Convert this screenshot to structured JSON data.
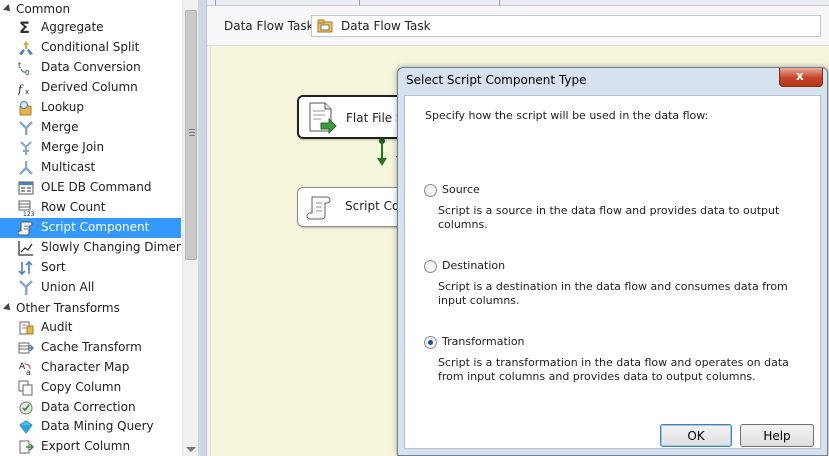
{
  "toolbox": {
    "groups": [
      {
        "label": "Common"
      },
      {
        "label": "Other Transforms"
      }
    ],
    "common_items": [
      {
        "label": "Aggregate",
        "icon": "sigma-icon"
      },
      {
        "label": "Conditional Split",
        "icon": "conditional-split-icon"
      },
      {
        "label": "Data Conversion",
        "icon": "data-conversion-icon"
      },
      {
        "label": "Derived Column",
        "icon": "derived-column-icon"
      },
      {
        "label": "Lookup",
        "icon": "lookup-icon"
      },
      {
        "label": "Merge",
        "icon": "merge-icon"
      },
      {
        "label": "Merge Join",
        "icon": "merge-join-icon"
      },
      {
        "label": "Multicast",
        "icon": "multicast-icon"
      },
      {
        "label": "OLE DB Command",
        "icon": "ole-db-command-icon"
      },
      {
        "label": "Row Count",
        "icon": "row-count-icon"
      },
      {
        "label": "Script Component",
        "icon": "script-component-icon"
      },
      {
        "label": "Slowly Changing Dimen...",
        "icon": "slowly-changing-dimension-icon"
      },
      {
        "label": "Sort",
        "icon": "sort-icon"
      },
      {
        "label": "Union All",
        "icon": "union-all-icon"
      }
    ],
    "other_items": [
      {
        "label": "Audit",
        "icon": "audit-icon"
      },
      {
        "label": "Cache Transform",
        "icon": "cache-transform-icon"
      },
      {
        "label": "Character Map",
        "icon": "character-map-icon"
      },
      {
        "label": "Copy Column",
        "icon": "copy-column-icon"
      },
      {
        "label": "Data Correction",
        "icon": "data-correction-icon"
      },
      {
        "label": "Data Mining Query",
        "icon": "data-mining-query-icon"
      },
      {
        "label": "Export Column",
        "icon": "export-column-icon"
      }
    ],
    "selected": "Script Component"
  },
  "designer": {
    "task_label": "Data Flow Task:",
    "task_value": "Data Flow Task",
    "components": {
      "source_label": "Flat File Sou",
      "script_label": "Script Comp"
    }
  },
  "dialog": {
    "title": "Select Script Component Type",
    "close_glyph": "x",
    "instruction": "Specify how the script will be used in the data flow:",
    "options": [
      {
        "label": "Source",
        "description": "Script is a source in the data flow and provides data to output columns.",
        "checked": false
      },
      {
        "label": "Destination",
        "description": "Script is a destination in the data flow and consumes data from input columns.",
        "checked": false
      },
      {
        "label": "Transformation",
        "description": "Script is a transformation in the data flow and operates on data from input columns and provides data to output columns.",
        "checked": true
      }
    ],
    "ok_label": "OK",
    "help_label": "Help"
  },
  "colors": {
    "selection": "#3399ff",
    "canvas": "#f5f5dc",
    "dialog_frame": "#d6e2f0",
    "close_button": "#c7442a"
  }
}
